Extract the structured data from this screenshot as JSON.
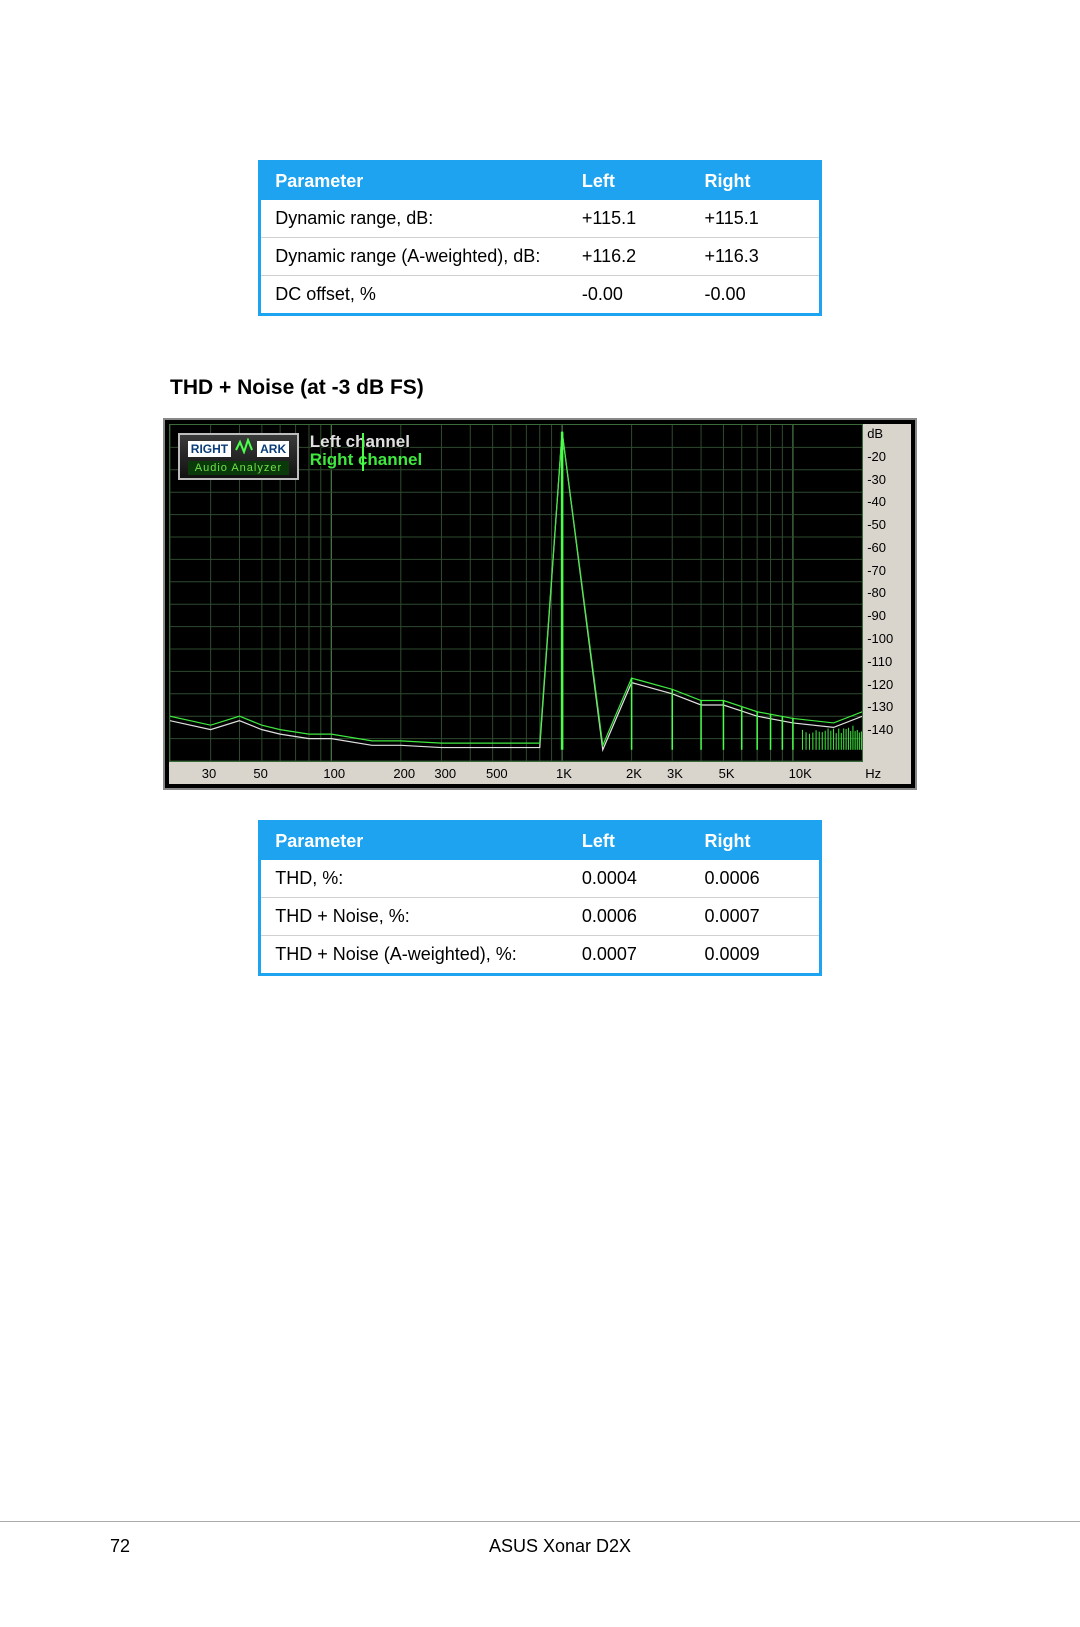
{
  "table1": {
    "headers": {
      "param": "Parameter",
      "left": "Left",
      "right": "Right"
    },
    "rows": [
      {
        "param": "Dynamic range, dB:",
        "left": "+115.1",
        "right": "+115.1"
      },
      {
        "param": "Dynamic range (A-weighted), dB:",
        "left": "+116.2",
        "right": "+116.3"
      },
      {
        "param": "DC offset, %",
        "left": "-0.00",
        "right": "-0.00"
      }
    ]
  },
  "section_title": "THD + Noise (at -3 dB FS)",
  "chart_data": {
    "type": "line",
    "title": "THD + Noise (at -3 dB FS)",
    "legend": {
      "brand_left": "RIGHT",
      "brand_right": "ARK",
      "brand_sub": "Audio Analyzer",
      "left_channel": "Left channel",
      "right_channel": "Right channel"
    },
    "xlabel": "Hz",
    "ylabel": "dB",
    "x_log": true,
    "xlim": [
      20,
      20000
    ],
    "ylim": [
      -150,
      0
    ],
    "x_ticks": [
      30,
      50,
      100,
      200,
      300,
      500,
      "1K",
      "2K",
      "3K",
      "5K",
      "10K"
    ],
    "y_ticks": [
      -20,
      -30,
      -40,
      -50,
      -60,
      -70,
      -80,
      -90,
      -100,
      -110,
      -120,
      -130,
      -140
    ],
    "series": [
      {
        "name": "Left channel",
        "color": "#e0e0e0",
        "x": [
          20,
          30,
          40,
          50,
          60,
          80,
          100,
          150,
          200,
          300,
          500,
          800,
          1000,
          1500,
          2000,
          3000,
          4000,
          5000,
          7000,
          10000,
          15000,
          20000
        ],
        "y": [
          -132,
          -136,
          -132,
          -136,
          -138,
          -140,
          -140,
          -143,
          -143,
          -144,
          -144,
          -144,
          -3,
          -145,
          -115,
          -120,
          -125,
          -125,
          -130,
          -133,
          -135,
          -130
        ]
      },
      {
        "name": "Right channel",
        "color": "#3fe83f",
        "x": [
          20,
          30,
          40,
          50,
          60,
          80,
          100,
          150,
          200,
          300,
          500,
          800,
          1000,
          1500,
          2000,
          3000,
          4000,
          5000,
          7000,
          10000,
          15000,
          20000
        ],
        "y": [
          -130,
          -134,
          -130,
          -134,
          -136,
          -138,
          -138,
          -141,
          -141,
          -142,
          -142,
          -142,
          -3,
          -143,
          -113,
          -118,
          -123,
          -123,
          -128,
          -131,
          -133,
          -128
        ]
      }
    ],
    "harmonic_peaks_hz_db": [
      [
        1000,
        -3
      ],
      [
        2000,
        -113
      ],
      [
        3000,
        -118
      ],
      [
        4000,
        -123
      ],
      [
        5000,
        -123
      ],
      [
        6000,
        -126
      ],
      [
        7000,
        -128
      ],
      [
        8000,
        -129
      ],
      [
        9000,
        -130
      ],
      [
        10000,
        -131
      ]
    ]
  },
  "table2": {
    "headers": {
      "param": "Parameter",
      "left": "Left",
      "right": "Right"
    },
    "rows": [
      {
        "param": "THD, %:",
        "left": "0.0004",
        "right": "0.0006"
      },
      {
        "param": "THD + Noise, %:",
        "left": "0.0006",
        "right": "0.0007"
      },
      {
        "param": "THD + Noise (A-weighted), %:",
        "left": "0.0007",
        "right": "0.0009"
      }
    ]
  },
  "footer": {
    "page_number": "72",
    "doc_title": "ASUS Xonar D2X"
  }
}
